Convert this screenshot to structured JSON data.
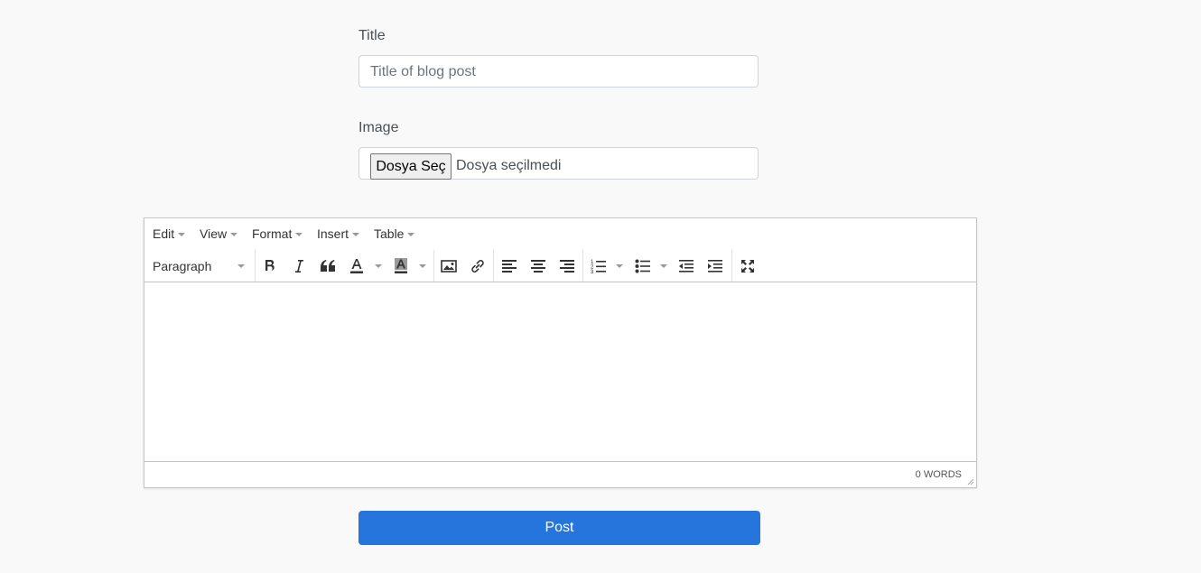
{
  "title_field": {
    "label": "Title",
    "placeholder": "Title of blog post"
  },
  "image_field": {
    "label": "Image",
    "button_label": "Dosya Seç",
    "status": "Dosya seçilmedi"
  },
  "editor": {
    "menu": [
      "Edit",
      "View",
      "Format",
      "Insert",
      "Table"
    ],
    "block_format": "Paragraph",
    "toolbar_icons": [
      "bold-icon",
      "italic-icon",
      "blockquote-icon",
      "text-color-icon",
      "background-color-icon",
      "image-icon",
      "link-icon",
      "align-left-icon",
      "align-center-icon",
      "align-right-icon",
      "numbered-list-icon",
      "bulleted-list-icon",
      "outdent-icon",
      "indent-icon",
      "fullscreen-icon"
    ],
    "word_count": "0 WORDS"
  },
  "submit": {
    "label": "Post",
    "color": "#2575dc"
  }
}
